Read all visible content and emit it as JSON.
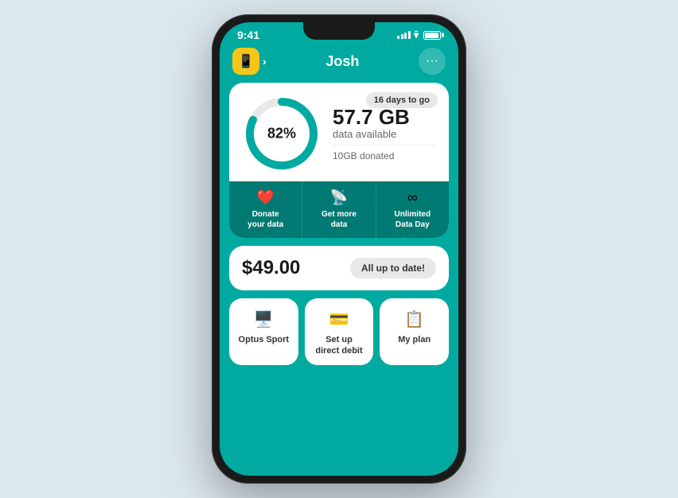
{
  "phone": {
    "status_bar": {
      "time": "9:41",
      "signal_bars": [
        4,
        6,
        8,
        10
      ],
      "wifi": "wifi",
      "battery": "battery"
    },
    "header": {
      "user_name": "Josh",
      "sim_icon": "📱",
      "chat_icon": "···"
    },
    "data_card": {
      "days_badge": "16 days to go",
      "percentage": "82%",
      "donut_progress": 82,
      "gb_amount": "57.7 GB",
      "data_label": "data available",
      "donated_text": "10GB donated"
    },
    "action_buttons": [
      {
        "icon": "❤️",
        "label": "Donate\nyour data"
      },
      {
        "icon": "📡",
        "label": "Get more\ndata"
      },
      {
        "icon": "∞",
        "label": "Unlimited\nData Day"
      }
    ],
    "bill_card": {
      "amount": "$49.00",
      "status": "All up to date!"
    },
    "tiles": [
      {
        "icon": "🖥️",
        "label": "Optus Sport"
      },
      {
        "icon": "💳",
        "label": "Set up\ndirect debit"
      },
      {
        "icon": "📋",
        "label": "My plan"
      }
    ],
    "colors": {
      "teal": "#00aaa0",
      "dark_teal": "#007a72",
      "yellow": "#f5c518",
      "white": "#ffffff",
      "bg": "#dce8ef"
    }
  }
}
